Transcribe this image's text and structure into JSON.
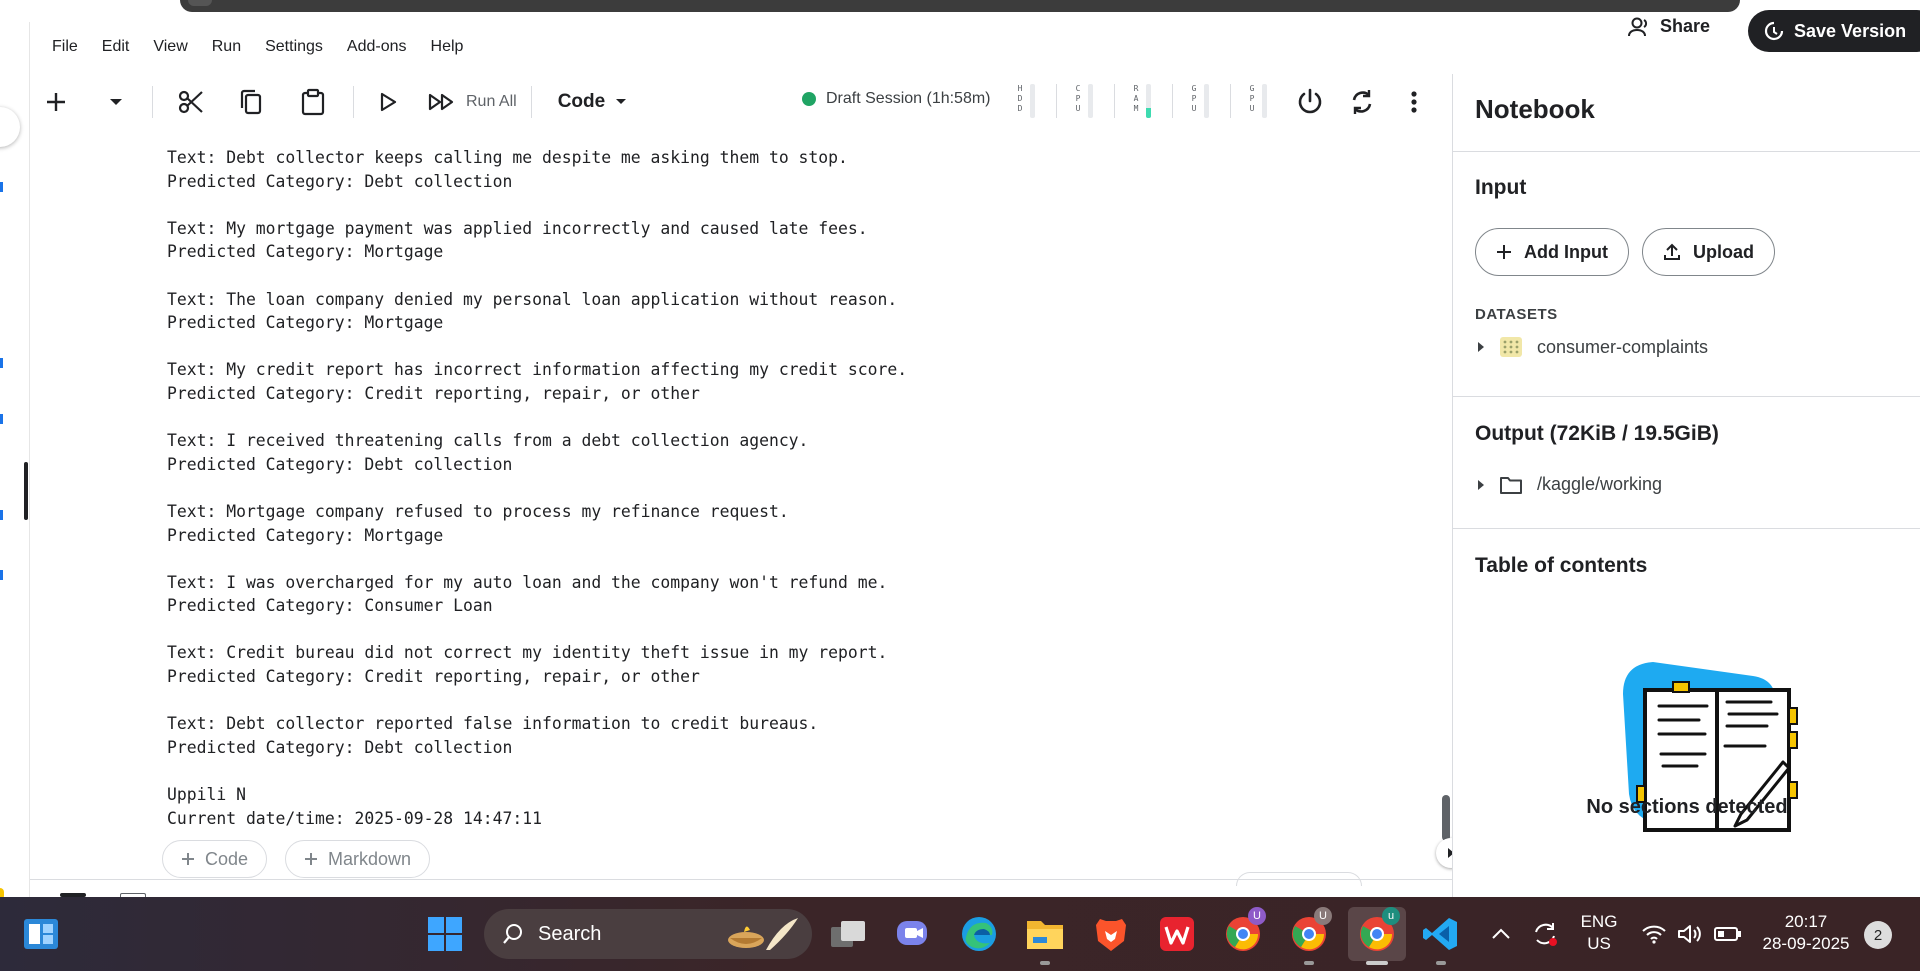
{
  "menu": [
    "File",
    "Edit",
    "View",
    "Run",
    "Settings",
    "Add-ons",
    "Help"
  ],
  "header": {
    "share_label": "Share",
    "save_version_label": "Save Version"
  },
  "toolbar": {
    "run_all_label": "Run All",
    "cell_type": "Code",
    "session_label": "Draft Session (1h:58m)",
    "meters": [
      {
        "label": "HDD",
        "level": 0
      },
      {
        "label": "CPU",
        "level": 0
      },
      {
        "label": "RAM",
        "level": 0.3
      },
      {
        "label": "GPU",
        "level": 0
      },
      {
        "label": "GPU",
        "level": 0
      }
    ]
  },
  "output": {
    "pairs": [
      {
        "text": "Text: Debt collector keeps calling me despite me asking them to stop.",
        "pred": "Predicted Category: Debt collection"
      },
      {
        "text": "Text: My mortgage payment was applied incorrectly and caused late fees.",
        "pred": "Predicted Category: Mortgage"
      },
      {
        "text": "Text: The loan company denied my personal loan application without reason.",
        "pred": "Predicted Category: Mortgage"
      },
      {
        "text": "Text: My credit report has incorrect information affecting my credit score.",
        "pred": "Predicted Category: Credit reporting, repair, or other"
      },
      {
        "text": "Text: I received threatening calls from a debt collection agency.",
        "pred": "Predicted Category: Debt collection"
      },
      {
        "text": "Text: Mortgage company refused to process my refinance request.",
        "pred": "Predicted Category: Mortgage"
      },
      {
        "text": "Text: I was overcharged for my auto loan and the company won't refund me.",
        "pred": "Predicted Category: Consumer Loan"
      },
      {
        "text": "Text: Credit bureau did not correct my identity theft issue in my report.",
        "pred": "Predicted Category: Credit reporting, repair, or other"
      },
      {
        "text": "Text: Debt collector reported false information to credit bureaus.",
        "pred": "Predicted Category: Debt collection"
      }
    ],
    "footer_name": "Uppili N",
    "footer_datetime": "Current date/time: 2025-09-28 14:47:11"
  },
  "add_cell": {
    "code_label": "Code",
    "markdown_label": "Markdown"
  },
  "sidebar": {
    "title": "Notebook",
    "input_heading": "Input",
    "add_input_label": "Add Input",
    "upload_label": "Upload",
    "datasets_label": "DATASETS",
    "dataset_name": "consumer-complaints",
    "output_heading": "Output (72KiB / 19.5GiB)",
    "output_path": "/kaggle/working",
    "toc_heading": "Table of contents",
    "toc_empty": "No sections detected"
  },
  "taskbar": {
    "search_placeholder": "Search",
    "lang_top": "ENG",
    "lang_bottom": "US",
    "time": "20:17",
    "date": "28-09-2025",
    "notification_count": "2",
    "chrome_profiles": [
      "U",
      "U",
      "u"
    ]
  },
  "colors": {
    "session_dot": "#20a464",
    "ram_meter": "#3ddbb0",
    "save_bg": "#202124"
  }
}
